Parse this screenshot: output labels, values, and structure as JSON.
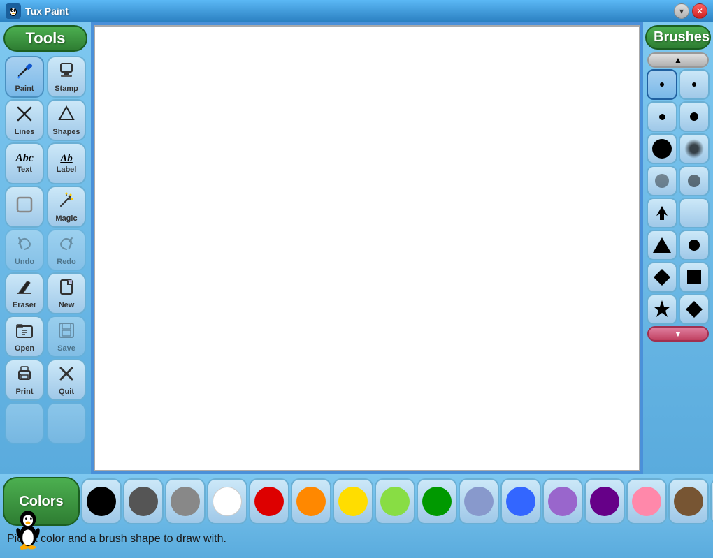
{
  "titlebar": {
    "title": "Tux Paint",
    "icon_label": "TP",
    "minimize_label": "▾",
    "close_label": "✕"
  },
  "tools_label": "Tools",
  "brushes_label": "Brushes",
  "colors_label": "Colors",
  "tools": [
    {
      "id": "paint",
      "label": "Paint",
      "icon": "🖌",
      "active": true
    },
    {
      "id": "stamp",
      "label": "Stamp",
      "icon": "🔲"
    },
    {
      "id": "lines",
      "label": "Lines",
      "icon": "✕"
    },
    {
      "id": "shapes",
      "label": "Shapes",
      "icon": "⬠"
    },
    {
      "id": "text",
      "label": "Text",
      "icon": "Abc"
    },
    {
      "id": "label",
      "label": "Label",
      "icon": "Ab"
    },
    {
      "id": "fill",
      "label": "",
      "icon": "⬜"
    },
    {
      "id": "magic",
      "label": "Magic",
      "icon": "✨"
    },
    {
      "id": "undo",
      "label": "Undo",
      "icon": "↩",
      "disabled": true
    },
    {
      "id": "redo",
      "label": "Redo",
      "icon": "↪",
      "disabled": true
    },
    {
      "id": "eraser",
      "label": "Eraser",
      "icon": "🧹"
    },
    {
      "id": "new",
      "label": "New",
      "icon": "📄"
    },
    {
      "id": "open",
      "label": "Open",
      "icon": "📖"
    },
    {
      "id": "save",
      "label": "Save",
      "icon": "📋",
      "disabled": true
    },
    {
      "id": "print",
      "label": "Print",
      "icon": "🖨"
    },
    {
      "id": "quit",
      "label": "Quit",
      "icon": "✕"
    }
  ],
  "colors": [
    {
      "id": "black",
      "color": "#000000",
      "active": false
    },
    {
      "id": "darkgray",
      "color": "#555555"
    },
    {
      "id": "gray",
      "color": "#888888"
    },
    {
      "id": "white",
      "color": "#ffffff"
    },
    {
      "id": "red",
      "color": "#dd0000"
    },
    {
      "id": "orange",
      "color": "#ff8800"
    },
    {
      "id": "yellow",
      "color": "#ffdd00"
    },
    {
      "id": "lightgreen",
      "color": "#88dd44"
    },
    {
      "id": "green",
      "color": "#009900"
    },
    {
      "id": "lightblue",
      "color": "#8899cc"
    },
    {
      "id": "blue",
      "color": "#3366ff"
    },
    {
      "id": "purple",
      "color": "#9966cc"
    },
    {
      "id": "darkpurple",
      "color": "#660088"
    },
    {
      "id": "pink",
      "color": "#ff88aa"
    },
    {
      "id": "brown",
      "color": "#775533"
    },
    {
      "id": "tan",
      "color": "#ccaa88"
    },
    {
      "id": "skin",
      "color": "#ffddcc"
    },
    {
      "id": "rainbow",
      "color": "special"
    },
    {
      "id": "black2",
      "color": "#111111"
    }
  ],
  "status": {
    "message": "Pick a color and a brush shape to draw with."
  },
  "brushes": [
    {
      "id": "brush-small-left",
      "size": 6,
      "type": "dot"
    },
    {
      "id": "brush-small-right",
      "size": 6,
      "type": "dot"
    },
    {
      "id": "brush-med-left",
      "size": 9,
      "type": "dot"
    },
    {
      "id": "brush-med-right",
      "size": 12,
      "type": "dot"
    },
    {
      "id": "brush-large-left",
      "size": 28,
      "type": "dot"
    },
    {
      "id": "brush-large-right",
      "size": 22,
      "type": "soft"
    },
    {
      "id": "brush-xl-left",
      "size": 20,
      "type": "dot",
      "opacity": "0.5"
    },
    {
      "id": "brush-xl-right",
      "size": 18,
      "type": "dot",
      "opacity": "0.7"
    },
    {
      "id": "brush-up-left",
      "size": 0,
      "type": "arrow"
    },
    {
      "id": "brush-up-right",
      "size": 0,
      "type": "empty"
    },
    {
      "id": "brush-tri-left",
      "size": 0,
      "type": "triangle"
    },
    {
      "id": "brush-tri-right",
      "size": 16,
      "type": "dot"
    },
    {
      "id": "brush-dia1-left",
      "size": 0,
      "type": "diamond"
    },
    {
      "id": "brush-dia1-right",
      "size": 0,
      "type": "square"
    },
    {
      "id": "brush-star-left",
      "size": 0,
      "type": "star"
    },
    {
      "id": "brush-dia2-right",
      "size": 0,
      "type": "diamond2"
    }
  ]
}
